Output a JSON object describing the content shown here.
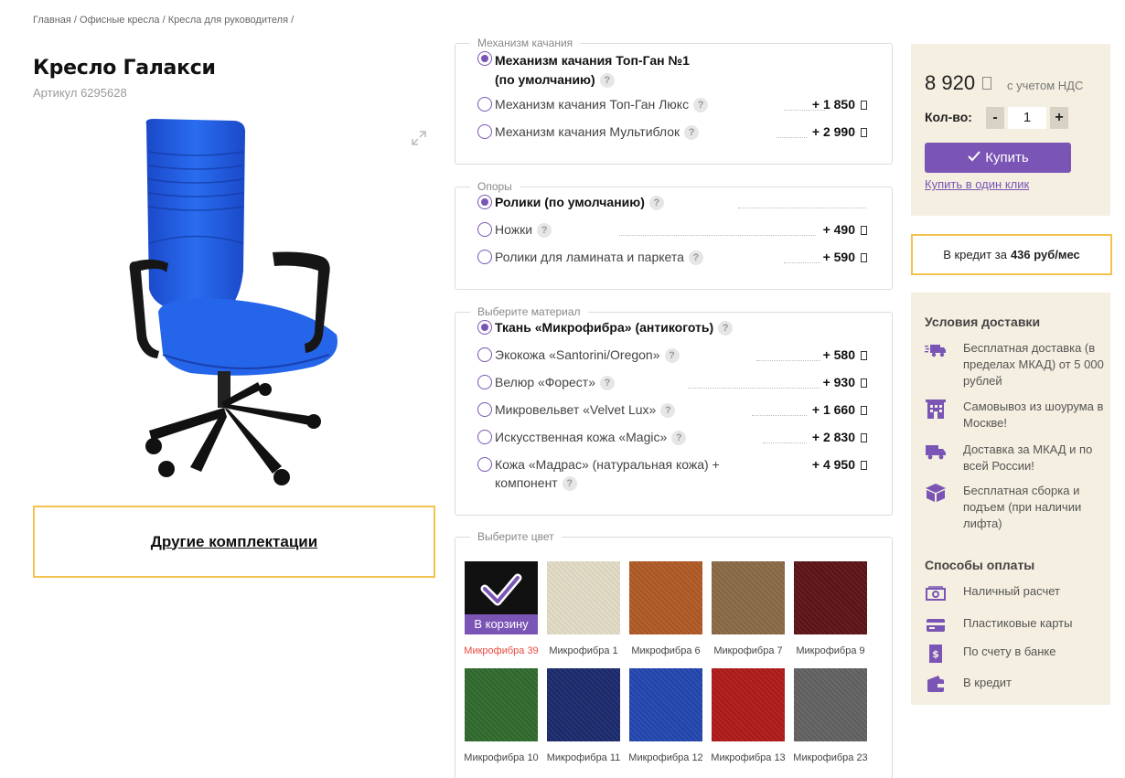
{
  "breadcrumb": {
    "text": "Главная / Офисные кресла / Кресла для руководителя /"
  },
  "product": {
    "title": "Кресло Галакси",
    "sku": "Артикул 6295628"
  },
  "other_configs": "Другие комплектации",
  "mechanism": {
    "legend": "Механизм качания",
    "options": [
      {
        "label_line1": "Механизм качания Топ-Ган №1",
        "label_line2": "(по умолчанию)",
        "price": "",
        "selected": true
      },
      {
        "label": "Механизм качания Топ-Ган Люкс",
        "price": "+ 1 850",
        "selected": false
      },
      {
        "label": "Механизм качания Мультиблок",
        "price": "+ 2 990",
        "selected": false
      }
    ]
  },
  "supports": {
    "legend": "Опоры",
    "options": [
      {
        "label": "Ролики (по умолчанию)",
        "price": "",
        "selected": true
      },
      {
        "label": "Ножки",
        "price": "+ 490",
        "selected": false
      },
      {
        "label": "Ролики для ламината и паркета",
        "price": "+ 590",
        "selected": false
      }
    ]
  },
  "material": {
    "legend": "Выберите материал",
    "options": [
      {
        "label": "Ткань «Микрофибра» (антикоготь)",
        "price": "",
        "selected": true
      },
      {
        "label": "Экокожа «Santorini/Oregon»",
        "price": "+ 580",
        "selected": false
      },
      {
        "label": "Велюр «Форест»",
        "price": "+ 930",
        "selected": false
      },
      {
        "label": "Микровельвет «Velvet Lux»",
        "price": "+ 1 660",
        "selected": false
      },
      {
        "label": "Искусственная кожа «Magic»",
        "price": "+ 2 830",
        "selected": false
      },
      {
        "label_line1": "Кожа «Мадрас» (натуральная кожа) +",
        "label_line2": "компонент",
        "price": "+ 4 950",
        "selected": false
      }
    ]
  },
  "color": {
    "legend": "Выберите цвет",
    "cart_label": "В корзину",
    "swatches": [
      {
        "name": "Микрофибра 39",
        "color": "#111111",
        "selected": true
      },
      {
        "name": "Микрофибра 1",
        "color": "#e3dcc6"
      },
      {
        "name": "Микрофибра 6",
        "color": "#b05a24"
      },
      {
        "name": "Микрофибра 7",
        "color": "#8a6a45"
      },
      {
        "name": "Микрофибра 9",
        "color": "#5e1418"
      },
      {
        "name": "Микрофибра 10",
        "color": "#2f6a2c"
      },
      {
        "name": "Микрофибра 11",
        "color": "#1b2a6e"
      },
      {
        "name": "Микрофибра 12",
        "color": "#2346b0"
      },
      {
        "name": "Микрофибра 13",
        "color": "#b01a1a"
      },
      {
        "name": "Микрофибра 23",
        "color": "#626262"
      }
    ]
  },
  "buy": {
    "price": "8 920",
    "vat": "с учетом НДС",
    "qty_label": "Кол-во:",
    "qty_minus": "-",
    "qty_value": "1",
    "qty_plus": "+",
    "buy_label": "Купить",
    "one_click": "Купить в один клик"
  },
  "credit": {
    "prefix": "В кредит за",
    "amount": "436 руб/мес"
  },
  "delivery": {
    "title": "Условия доставки",
    "items": [
      {
        "icon": "truck-fast-icon",
        "text": "Бесплатная доставка (в пределах МКАД) от 5 000 рублей"
      },
      {
        "icon": "building-icon",
        "text": "Самовывоз из шоурума в Москве!"
      },
      {
        "icon": "truck-icon",
        "text": "Доставка за МКАД и по всей России!"
      },
      {
        "icon": "box-icon",
        "text": "Бесплатная сборка и подъем (при наличии лифта)"
      }
    ]
  },
  "payment": {
    "title": "Способы оплаты",
    "items": [
      {
        "icon": "cash-icon",
        "text": "Наличный расчет"
      },
      {
        "icon": "card-icon",
        "text": "Пластиковые карты"
      },
      {
        "icon": "bank-invoice-icon",
        "text": "По счету в банке"
      },
      {
        "icon": "wallet-icon",
        "text": "В кредит"
      }
    ]
  },
  "colors": {
    "accent": "#7a55b5",
    "panel": "#f4efe0",
    "highlight_border": "#f3c34e",
    "active_label": "#e8493f"
  }
}
